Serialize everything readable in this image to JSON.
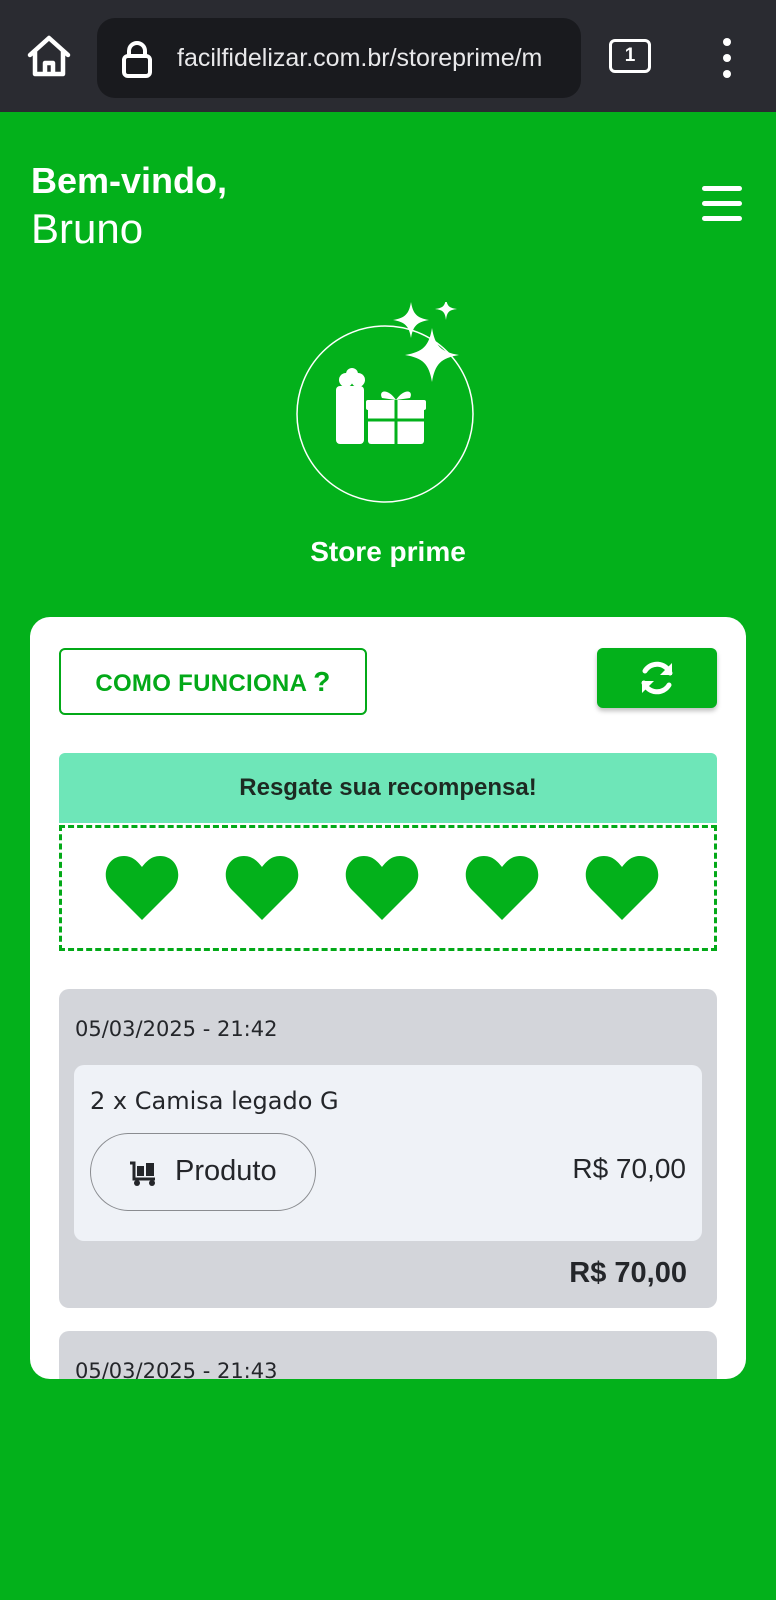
{
  "browser": {
    "url": "facilfidelizar.com.br/storeprime/m",
    "tab_count": "1"
  },
  "header": {
    "welcome": "Bem-vindo,",
    "user_name": "Bruno"
  },
  "store": {
    "title": "Store prime"
  },
  "card": {
    "how_it_works_label": "COMO FUNCIONA",
    "how_it_works_suffix": "?",
    "reward_banner": "Resgate sua recompensa!",
    "hearts_filled": 5,
    "hearts_total": 5
  },
  "history": [
    {
      "date": "05/03/2025 - 21:42",
      "description": "2 x Camisa legado G",
      "type": "Produto",
      "price": "R$ 70,00",
      "total": "R$ 70,00"
    },
    {
      "date": "05/03/2025 - 21:43"
    }
  ],
  "colors": {
    "brand_green": "#03b11b",
    "banner_mint": "#6ee6b8",
    "browser_bar": "#2a2b31"
  },
  "icons": [
    "home-icon",
    "lock-icon",
    "tabs-icon",
    "more-vert-icon",
    "hamburger-menu-icon",
    "gift-sparkles-icon",
    "refresh-icon",
    "heart-icon",
    "cart-icon"
  ]
}
